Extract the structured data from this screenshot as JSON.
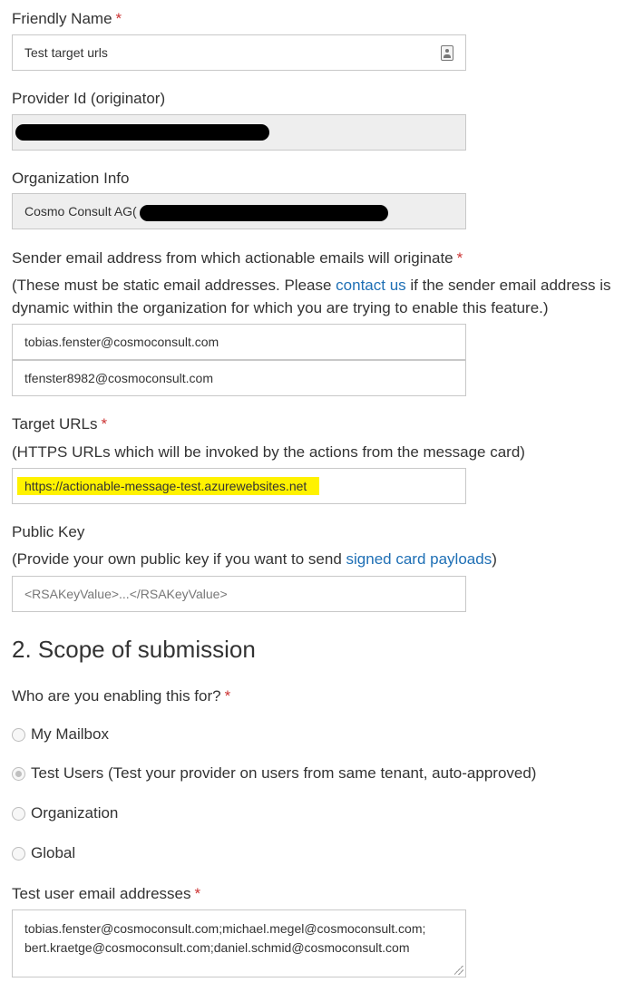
{
  "friendly_name": {
    "label": "Friendly Name",
    "required_mark": "*",
    "value": "Test target urls",
    "icon": "contact-card-icon"
  },
  "provider_id": {
    "label": "Provider Id (originator)"
  },
  "organization_info": {
    "label": "Organization Info",
    "value": "Cosmo Consult AG("
  },
  "sender_email": {
    "label": "Sender email address from which actionable emails will originate",
    "required_mark": "*",
    "note_before": "(These must be static email addresses. Please ",
    "note_link": "contact us",
    "note_after_line1": " if the sender email address is",
    "note_line2": "dynamic within the organization for which you are trying to enable this feature.)",
    "emails": [
      "tobias.fenster@cosmoconsult.com",
      "tfenster8982@cosmoconsult.com"
    ]
  },
  "target_urls": {
    "label": "Target URLs",
    "required_mark": "*",
    "note": "(HTTPS URLs which will be invoked by the actions from the message card)",
    "value": "https://actionable-message-test.azurewebsites.net",
    "highlight_color": "#fff200"
  },
  "public_key": {
    "label": "Public Key",
    "note_before": "(Provide your own public key if you want to send ",
    "note_link": "signed card payloads",
    "note_after": ")",
    "placeholder": "<RSAKeyValue>...</RSAKeyValue>"
  },
  "scope": {
    "heading": "2. Scope of submission",
    "question": "Who are you enabling this for?",
    "required_mark": "*",
    "options": [
      {
        "label": "My Mailbox",
        "checked": false
      },
      {
        "label": "Test Users (Test your provider on users from same tenant, auto-approved)",
        "checked": true
      },
      {
        "label": "Organization",
        "checked": false
      },
      {
        "label": "Global",
        "checked": false
      }
    ]
  },
  "test_users": {
    "label": "Test user email addresses",
    "required_mark": "*",
    "line1": "tobias.fenster@cosmoconsult.com;michael.megel@cosmoconsult.com;",
    "line2": "bert.kraetge@cosmoconsult.com;daniel.schmid@cosmoconsult.com"
  },
  "colors": {
    "link": "#1e6fb5",
    "required": "#cc3333",
    "readonly_bg": "#eeeeee",
    "border": "#c8c8c8"
  }
}
